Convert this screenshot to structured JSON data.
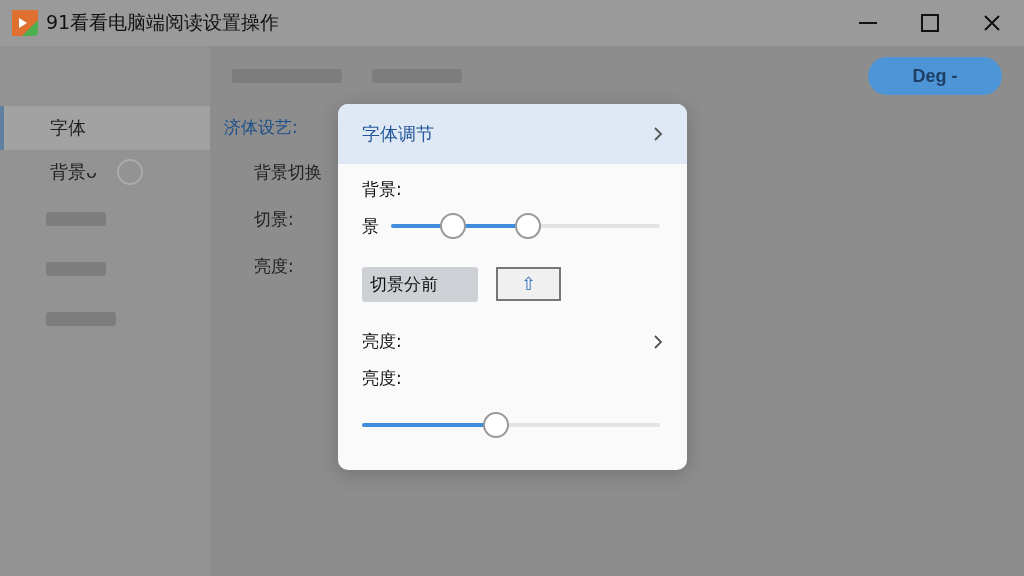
{
  "window": {
    "title": "91看看电脑端阅读设置操作"
  },
  "sidebar": {
    "items": [
      {
        "label": "字体",
        "selected": true
      },
      {
        "label": "背景ᴗ⁠",
        "selected": false
      }
    ]
  },
  "content": {
    "section_title": "济体设艺:",
    "rows": [
      "背景切换",
      "切景:",
      "亮度:"
    ]
  },
  "toolbar": {
    "button": "Deg -"
  },
  "popup": {
    "title": "字体调节",
    "background_label": "背景:",
    "range_label": "景",
    "range": [
      {
        "level": 0.23
      },
      {
        "level": 0.51
      }
    ],
    "toggle_label": "切景分前",
    "toggle_button": "⇧",
    "brightness_row": "亮度:",
    "brightness_label": "亮度:",
    "brightness": {
      "level": 0.45
    }
  }
}
